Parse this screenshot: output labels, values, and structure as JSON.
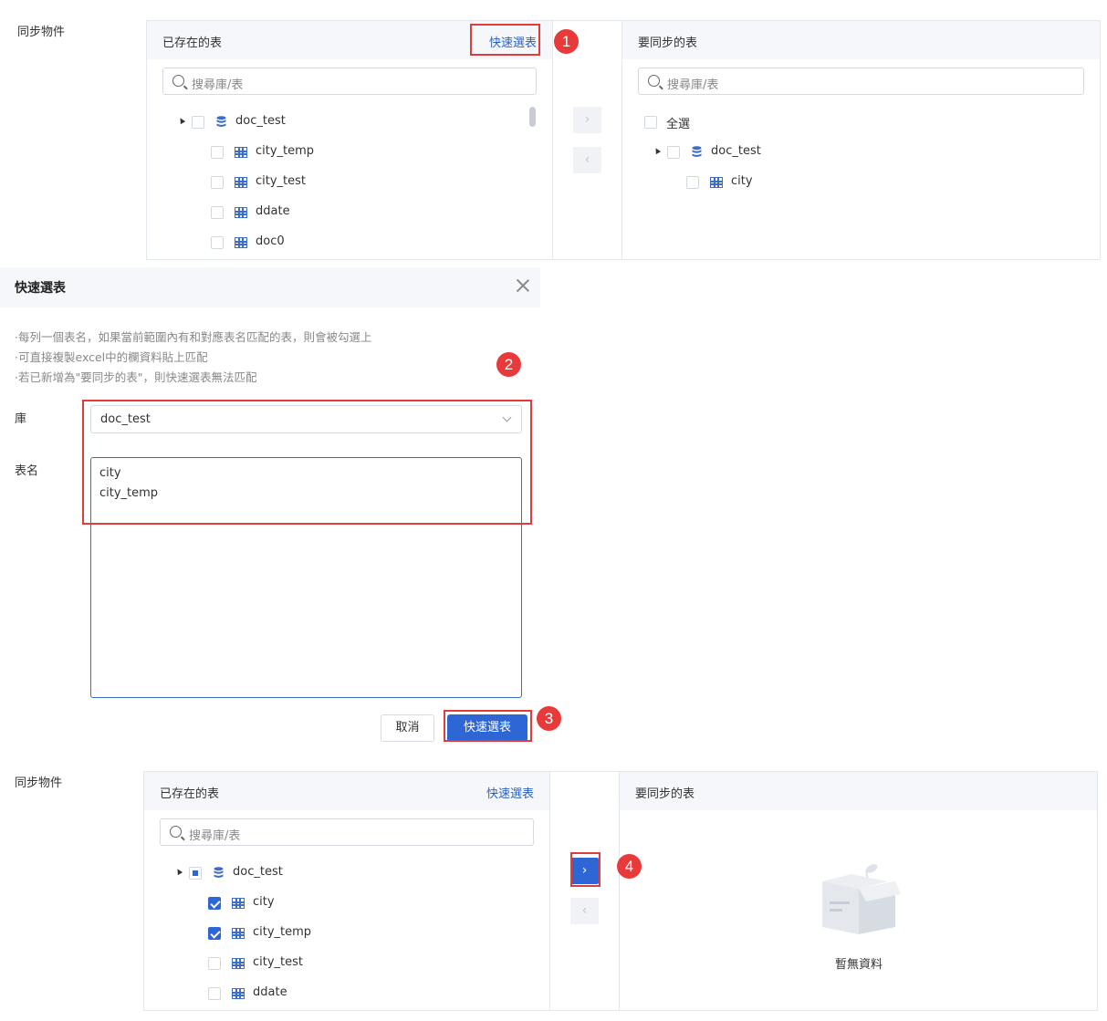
{
  "top_section": {
    "label": "同步物件",
    "left_panel": {
      "title": "已存在的表",
      "quick_link": "快速選表",
      "search_placeholder": "搜尋庫/表",
      "db": "doc_test",
      "tables": [
        "city_temp",
        "city_test",
        "ddate",
        "doc0"
      ]
    },
    "right_panel": {
      "title": "要同步的表",
      "search_placeholder": "搜尋庫/表",
      "select_all": "全選",
      "db": "doc_test",
      "tables": [
        "city"
      ]
    }
  },
  "dialog": {
    "title": "快速選表",
    "hints": [
      "·每列一個表名，如果當前範圍內有和對應表名匹配的表，則會被勾選上",
      "·可直接複製excel中的欄資料貼上匹配",
      "·若已新增為\"要同步的表\"，則快速選表無法匹配"
    ],
    "db_label": "庫",
    "db_value": "doc_test",
    "table_label": "表名",
    "table_lines": [
      "city",
      "city_temp"
    ],
    "cancel": "取消",
    "confirm": "快速選表"
  },
  "bottom_section": {
    "label": "同步物件",
    "left_panel": {
      "title": "已存在的表",
      "quick_link": "快速選表",
      "search_placeholder": "搜尋庫/表",
      "db": "doc_test",
      "tables": [
        {
          "name": "city",
          "checked": true
        },
        {
          "name": "city_temp",
          "checked": true
        },
        {
          "name": "city_test",
          "checked": false
        },
        {
          "name": "ddate",
          "checked": false
        }
      ]
    },
    "right_panel": {
      "title": "要同步的表",
      "empty_text": "暫無資料"
    }
  },
  "steps": [
    "1",
    "2",
    "3",
    "4"
  ],
  "colors": {
    "accent": "#2f66d6",
    "annotation": "#e03c3c",
    "link": "#2a62c9"
  }
}
